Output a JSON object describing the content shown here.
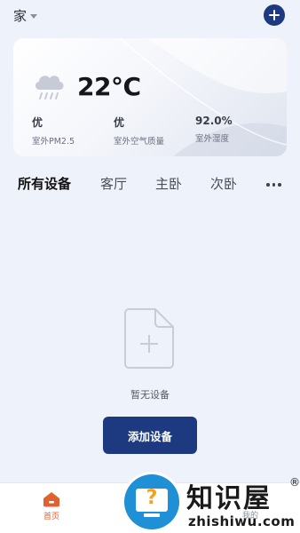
{
  "header": {
    "home_name": "家",
    "add_icon": "plus-circle-icon"
  },
  "weather": {
    "icon": "rain-cloud-icon",
    "temperature": "22°C",
    "stats": [
      {
        "value": "优",
        "label": "室外PM2.5"
      },
      {
        "value": "优",
        "label": "室外空气质量"
      },
      {
        "value": "92.0%",
        "label": "室外湿度"
      }
    ]
  },
  "tabs": [
    {
      "label": "所有设备",
      "active": true
    },
    {
      "label": "客厅",
      "active": false
    },
    {
      "label": "主卧",
      "active": false
    },
    {
      "label": "次卧",
      "active": false
    }
  ],
  "more_icon": "more-dots-icon",
  "empty_state": {
    "icon": "empty-file-plus-icon",
    "text": "暂无设备",
    "button_label": "添加设备"
  },
  "bottom_nav": {
    "items": [
      {
        "label": "首页",
        "icon": "home-icon",
        "active": true
      },
      {
        "label": "我的",
        "icon": "user-icon",
        "active": false
      }
    ]
  },
  "watermark": {
    "title": "知识屋",
    "registered": "®",
    "subtitle": "zhishiwu.com"
  },
  "colors": {
    "background": "#eef2fb",
    "primary": "#1d3a80",
    "active_nav": "#e0632f"
  }
}
